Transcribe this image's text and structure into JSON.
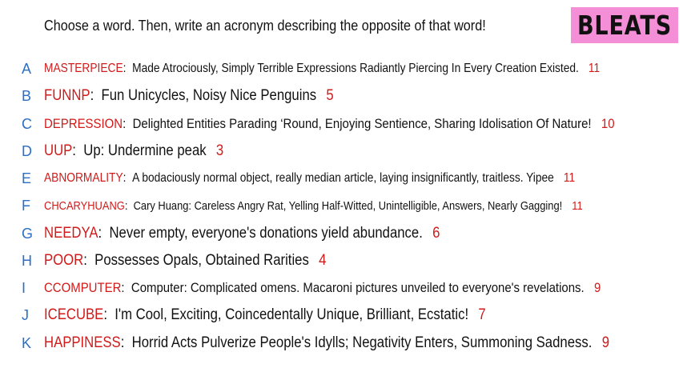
{
  "prompt": "Choose a word. Then, write an acronym describing the opposite of that word!",
  "logo_text": "BLEATS",
  "colors": {
    "letter": "#2c6fc5",
    "word": "#d11a1a",
    "count": "#d11a1a",
    "logo_bg": "#f48ed6"
  },
  "entries": [
    {
      "letter": "A",
      "word": "MASTERPIECE",
      "definition": "Made Atrociously, Simply Terrible Expressions Radiantly Piercing In Every Creation Existed.",
      "count": "11"
    },
    {
      "letter": "B",
      "word": "FUNNP",
      "definition": "Fun Unicycles, Noisy Nice Penguins",
      "count": "5"
    },
    {
      "letter": "C",
      "word": "DEPRESSION",
      "definition": "Delighted Entities Parading ‘Round, Enjoying Sentience, Sharing Idolisation Of Nature!",
      "count": "10"
    },
    {
      "letter": "D",
      "word": "UUP",
      "definition": "Up: Undermine peak",
      "count": "3"
    },
    {
      "letter": "E",
      "word": "ABNORMALITY",
      "definition": "A bodaciously normal object, really median article, laying insignificantly, traitless. Yipee",
      "count": "11"
    },
    {
      "letter": "F",
      "word": "CHCARYHUANG",
      "definition": "Cary Huang: Careless Angry Rat, Yelling Half-Witted, Unintelligible, Answers, Nearly Gagging!",
      "count": "11"
    },
    {
      "letter": "G",
      "word": "NEEDYA",
      "definition": "Never empty, everyone's donations yield abundance.",
      "count": "6"
    },
    {
      "letter": "H",
      "word": "POOR",
      "definition": "Possesses Opals, Obtained Rarities",
      "count": "4"
    },
    {
      "letter": "I",
      "word": "CCOMPUTER",
      "definition": "Computer: Complicated omens. Macaroni pictures unveiled to everyone's revelations.",
      "count": "9"
    },
    {
      "letter": "J",
      "word": "ICECUBE",
      "definition": "I'm Cool, Exciting, Coincedentally Unique, Brilliant, Ecstatic!",
      "count": "7"
    },
    {
      "letter": "K",
      "word": "HAPPINESS",
      "definition": "Horrid Acts Pulverize People's Idylls; Negativity Enters, Summoning Sadness.",
      "count": "9"
    }
  ]
}
